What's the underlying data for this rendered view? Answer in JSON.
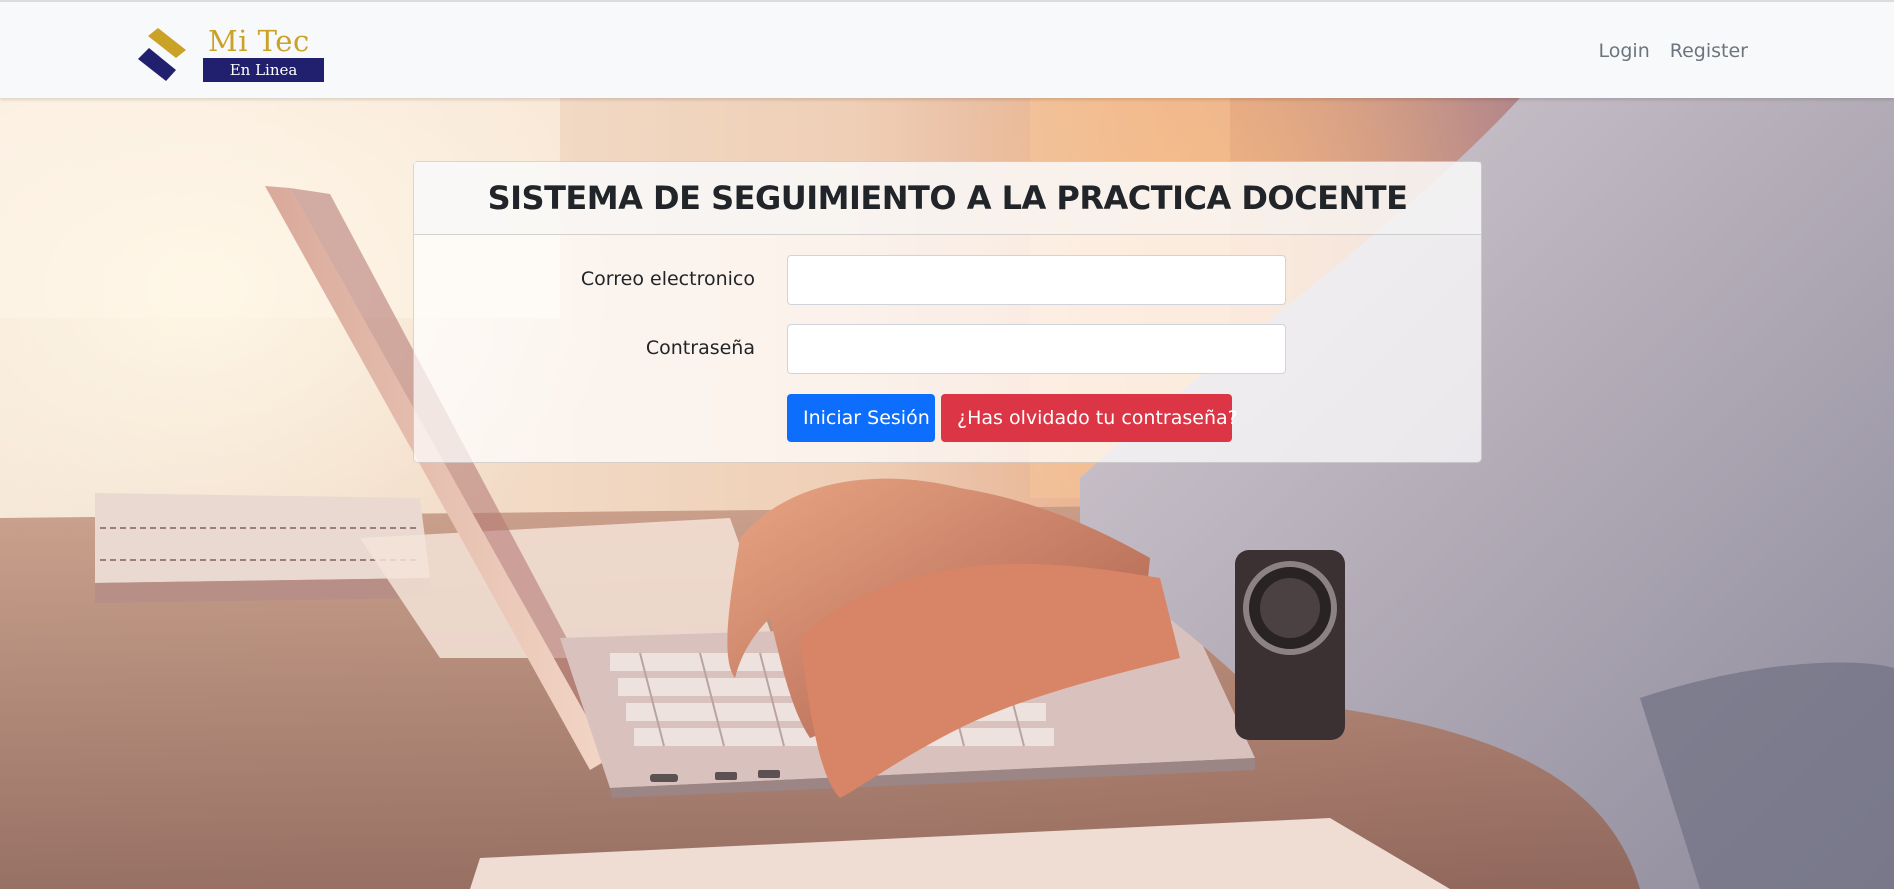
{
  "navbar": {
    "logo": {
      "top_text": "Mi Tec",
      "bottom_text": "En Linea"
    },
    "links": [
      {
        "label": "Login"
      },
      {
        "label": "Register"
      }
    ]
  },
  "login_card": {
    "title": "SISTEMA DE SEGUIMIENTO A LA PRACTICA DOCENTE",
    "email": {
      "label": "Correo electronico",
      "value": "",
      "placeholder": ""
    },
    "password": {
      "label": "Contraseña",
      "value": "",
      "placeholder": ""
    },
    "submit_label": "Iniciar Sesión",
    "forgot_label": "¿Has olvidado tu contraseña?"
  },
  "colors": {
    "logo_gold": "#c9a227",
    "logo_navy": "#21206e",
    "primary": "#0d6efd",
    "danger": "#dc3545",
    "navbar_bg": "#f8f9fa",
    "nav_link": "#6c757d"
  },
  "background": {
    "description_icon": "laptop-typing-photo"
  }
}
